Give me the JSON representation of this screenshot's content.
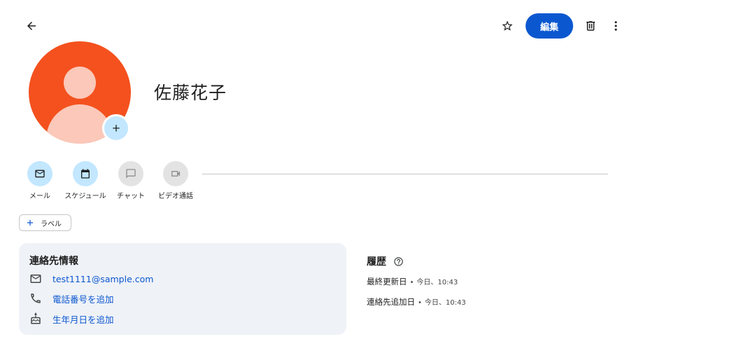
{
  "toolbar": {
    "back_icon": "arrow-back-icon",
    "star_icon": "star-outline-icon",
    "edit_label": "編集",
    "trash_icon": "trash-icon",
    "more_icon": "more-vert-icon"
  },
  "contact": {
    "name": "佐藤花子",
    "avatar_color": "#f4511e",
    "avatar_add_icon": "plus-icon"
  },
  "actions": [
    {
      "label": "メール",
      "icon": "mail-icon",
      "enabled": true
    },
    {
      "label": "スケジュール",
      "icon": "calendar-icon",
      "enabled": true
    },
    {
      "label": "チャット",
      "icon": "chat-icon",
      "enabled": false
    },
    {
      "label": "ビデオ通話",
      "icon": "video-icon",
      "enabled": false
    }
  ],
  "label_chip": {
    "label": "ラベル",
    "icon": "plus-icon"
  },
  "contact_info": {
    "title": "連絡先情報",
    "email": "test1111@sample.com",
    "phone": "電話番号を追加",
    "birthday": "生年月日を追加"
  },
  "history": {
    "title": "履歴",
    "help_icon": "help-circle-icon",
    "updated_label": "最終更新日",
    "updated_time": "今日、10:43",
    "added_label": "連絡先追加日",
    "added_time": "今日、10:43"
  },
  "colors": {
    "accent": "#0b57d0",
    "chip_bg": "#c2e7ff",
    "card_bg": "#eff2f7"
  }
}
